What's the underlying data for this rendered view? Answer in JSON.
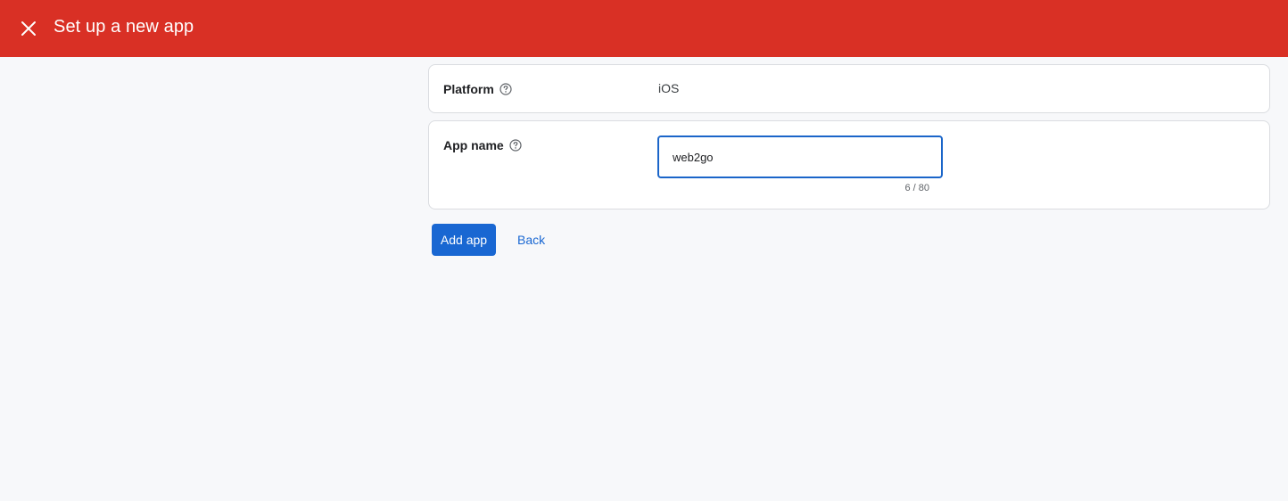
{
  "header": {
    "title": "Set up a new app",
    "bg_color": "#d93025",
    "close_icon": "close-icon"
  },
  "platform": {
    "label": "Platform",
    "help_icon": "help-circle-icon",
    "value": "iOS"
  },
  "app_name": {
    "label": "App name",
    "help_icon": "help-circle-icon",
    "value": "web2go",
    "counter": "6 / 80"
  },
  "actions": {
    "add_label": "Add app",
    "back_label": "Back"
  },
  "colors": {
    "primary": "#1967d2",
    "header": "#d93025",
    "background": "#f7f8fa"
  }
}
